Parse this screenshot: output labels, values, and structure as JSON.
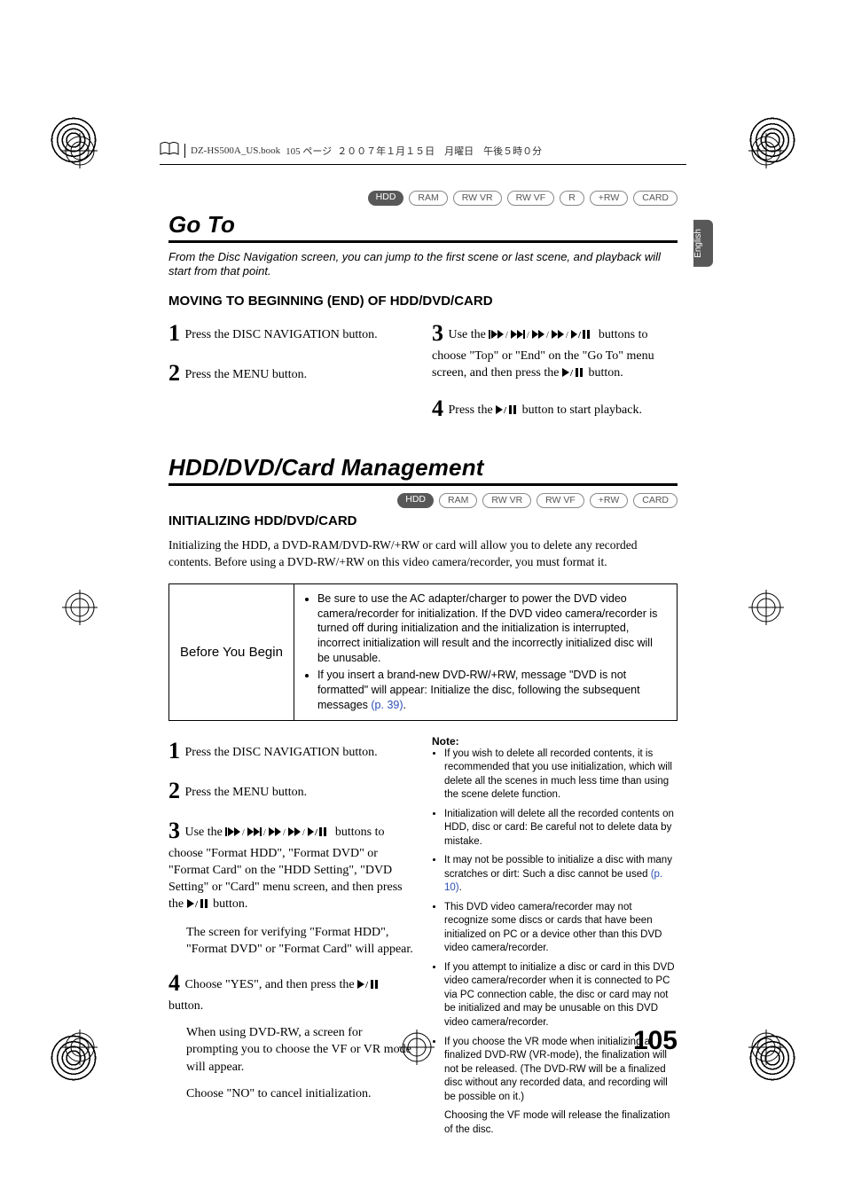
{
  "running_head": {
    "filename": "DZ-HS500A_US.book",
    "page_label": "105 ページ",
    "date": "２００７年１月１５日　月曜日　午後５時０分"
  },
  "side_tab": "English",
  "badges_row1": [
    "HDD",
    "RAM",
    "RW VR",
    "RW VF",
    "R",
    "+RW",
    "CARD"
  ],
  "badges_row2": [
    "HDD",
    "RAM",
    "RW VR",
    "RW VF",
    "+RW",
    "CARD"
  ],
  "section1": {
    "title": "Go To",
    "intro": "From the Disc Navigation screen, you can jump to the first scene or last scene, and playback will start from that point.",
    "subhead": "MOVING TO BEGINNING (END) OF HDD/DVD/CARD",
    "steps_left": [
      "Press the DISC NAVIGATION button.",
      "Press the MENU button."
    ],
    "step3_a": "Use the ",
    "step3_b": " buttons to choose \"Top\" or \"End\" on the \"Go To\" menu screen, and then press the ",
    "step3_c": " button.",
    "step4_a": "Press the ",
    "step4_b": " button to start playback."
  },
  "section2": {
    "title": "HDD/DVD/Card Management",
    "subhead": "INITIALIZING HDD/DVD/CARD",
    "intro": "Initializing the HDD, a DVD-RAM/DVD-RW/+RW or card will allow you to delete any recorded contents. Before using a DVD-RW/+RW on this video camera/recorder, you must format it.",
    "byb_label": "Before You Begin",
    "byb_items": [
      "Be sure to use the AC adapter/charger to power the DVD video camera/recorder for initialization. If the DVD video camera/recorder is turned off during initialization and the initialization is interrupted, incorrect initialization will result and the incorrectly initialized disc will be unusable.",
      "If you insert a brand-new DVD-RW/+RW, message \"DVD is not formatted\" will appear: Initialize the disc, following the subsequent messages "
    ],
    "byb_link": "(p. 39)",
    "byb_tail": ".",
    "left_steps": {
      "s1": "Press the DISC NAVIGATION button.",
      "s2": "Press the MENU button.",
      "s3a": "Use the ",
      "s3b": " buttons to choose \"Format HDD\", \"Format DVD\" or \"Format Card\" on the \"HDD Setting\", \"DVD Setting\" or \"Card\" menu screen, and then press the ",
      "s3c": " button.",
      "s3_follow": "The screen for verifying \"Format HDD\", \"Format DVD\" or \"Format Card\" will appear.",
      "s4a": "Choose \"YES\", and then press the ",
      "s4b": " button.",
      "s4_follow1": "When using DVD-RW, a screen for prompting you to choose the VF or VR mode will appear.",
      "s4_follow2": "Choose \"NO\" to cancel initialization."
    },
    "note_label": "Note:",
    "notes": [
      "If you wish to delete all recorded contents, it is recommended that you use initialization, which will delete all the scenes in much less time than using the scene delete function.",
      "Initialization will delete all the recorded contents on HDD, disc or card: Be careful not to delete data by mistake.",
      "It may not be possible to initialize a disc with many scratches or dirt: Such a disc cannot be used ",
      "This DVD video camera/recorder may not recognize some discs or cards that have been initialized on PC or a device other than this DVD video camera/recorder.",
      "If you attempt to initialize a disc or card in this DVD video camera/recorder when it is connected to PC via PC connection cable, the disc or card may not be initialized and may be unusable on this DVD video camera/recorder.",
      "If you choose the VR mode when initializing a finalized DVD-RW (VR-mode), the finalization will not be released. (The DVD-RW will be a finalized disc without any recorded data, and recording will be possible on it.)"
    ],
    "note3_link": "(p. 10)",
    "note3_tail": ".",
    "note_follow": "Choosing the VF mode will release the finalization of the disc."
  },
  "page_number": "105"
}
